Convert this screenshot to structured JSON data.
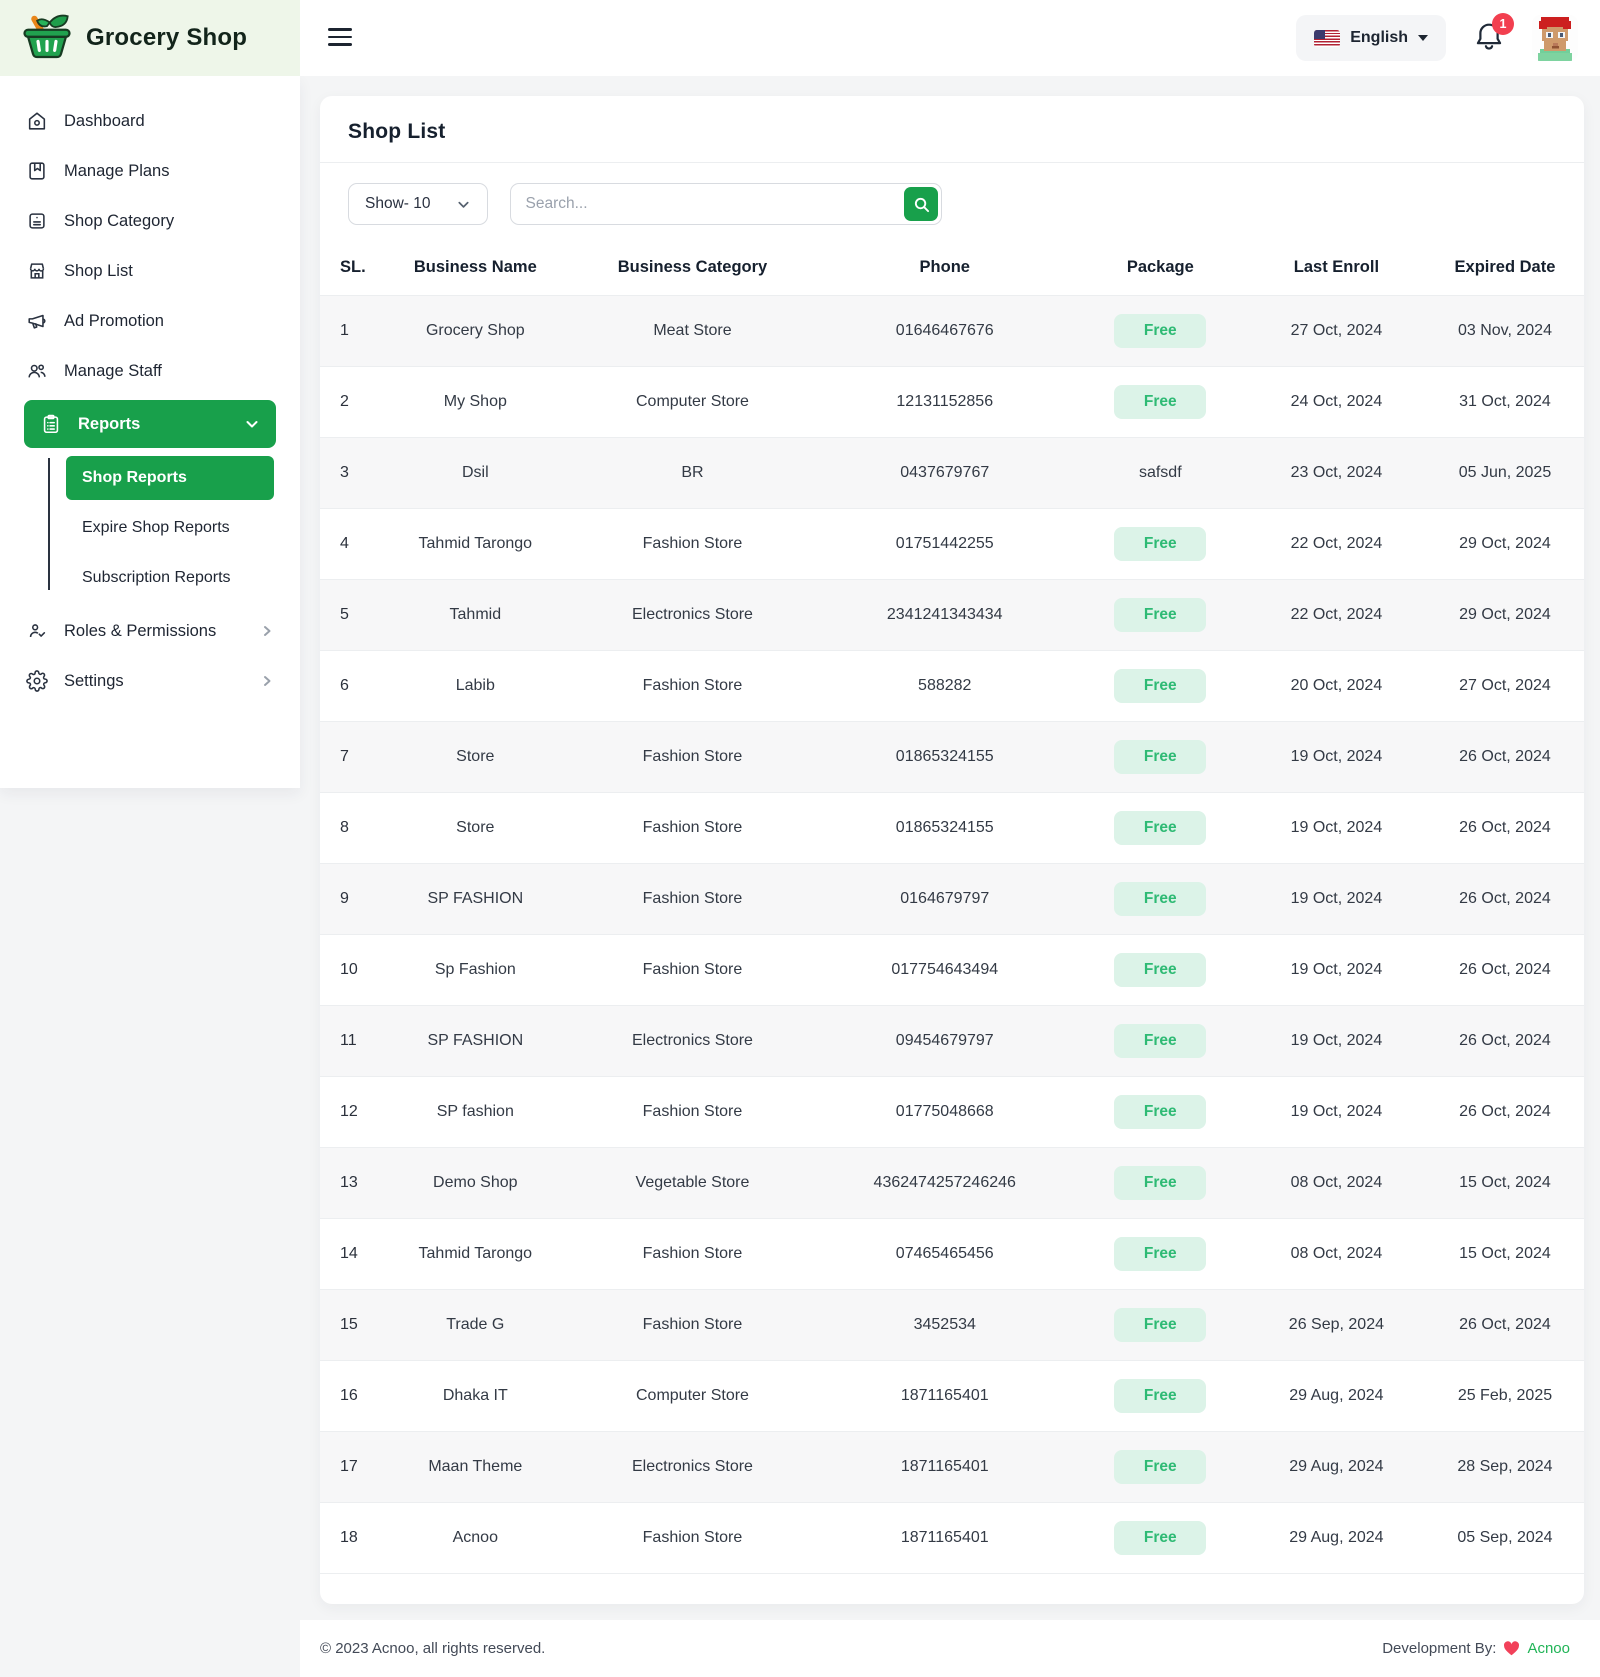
{
  "brand": {
    "name": "Grocery Shop"
  },
  "header": {
    "language": "English",
    "notification_count": "1"
  },
  "sidebar": {
    "items": [
      {
        "label": "Dashboard"
      },
      {
        "label": "Manage Plans"
      },
      {
        "label": "Shop Category"
      },
      {
        "label": "Shop List"
      },
      {
        "label": "Ad Promotion"
      },
      {
        "label": "Manage Staff"
      },
      {
        "label": "Reports"
      },
      {
        "label": "Roles & Permissions"
      },
      {
        "label": "Settings"
      }
    ],
    "reports_submenu": [
      {
        "label": "Shop Reports",
        "active": true
      },
      {
        "label": "Expire Shop Reports",
        "active": false
      },
      {
        "label": "Subscription Reports",
        "active": false
      }
    ]
  },
  "main": {
    "title": "Shop List",
    "show_select": "Show- 10",
    "search_placeholder": "Search...",
    "table": {
      "columns": [
        "SL.",
        "Business Name",
        "Business Category",
        "Phone",
        "Package",
        "Last Enroll",
        "Expired Date"
      ],
      "rows": [
        {
          "sl": "1",
          "name": "Grocery Shop",
          "category": "Meat Store",
          "phone": "01646467676",
          "package": "Free",
          "package_badge": true,
          "last_enroll": "27 Oct, 2024",
          "expired": "03 Nov, 2024"
        },
        {
          "sl": "2",
          "name": "My Shop",
          "category": "Computer Store",
          "phone": "12131152856",
          "package": "Free",
          "package_badge": true,
          "last_enroll": "24 Oct, 2024",
          "expired": "31 Oct, 2024"
        },
        {
          "sl": "3",
          "name": "Dsil",
          "category": "BR",
          "phone": "0437679767",
          "package": "safsdf",
          "package_badge": false,
          "last_enroll": "23 Oct, 2024",
          "expired": "05 Jun, 2025"
        },
        {
          "sl": "4",
          "name": "Tahmid Tarongo",
          "category": "Fashion Store",
          "phone": "01751442255",
          "package": "Free",
          "package_badge": true,
          "last_enroll": "22 Oct, 2024",
          "expired": "29 Oct, 2024"
        },
        {
          "sl": "5",
          "name": "Tahmid",
          "category": "Electronics Store",
          "phone": "2341241343434",
          "package": "Free",
          "package_badge": true,
          "last_enroll": "22 Oct, 2024",
          "expired": "29 Oct, 2024"
        },
        {
          "sl": "6",
          "name": "Labib",
          "category": "Fashion Store",
          "phone": "588282",
          "package": "Free",
          "package_badge": true,
          "last_enroll": "20 Oct, 2024",
          "expired": "27 Oct, 2024"
        },
        {
          "sl": "7",
          "name": "Store",
          "category": "Fashion Store",
          "phone": "01865324155",
          "package": "Free",
          "package_badge": true,
          "last_enroll": "19 Oct, 2024",
          "expired": "26 Oct, 2024"
        },
        {
          "sl": "8",
          "name": "Store",
          "category": "Fashion Store",
          "phone": "01865324155",
          "package": "Free",
          "package_badge": true,
          "last_enroll": "19 Oct, 2024",
          "expired": "26 Oct, 2024"
        },
        {
          "sl": "9",
          "name": "SP FASHION",
          "category": "Fashion Store",
          "phone": "0164679797",
          "package": "Free",
          "package_badge": true,
          "last_enroll": "19 Oct, 2024",
          "expired": "26 Oct, 2024"
        },
        {
          "sl": "10",
          "name": "Sp Fashion",
          "category": "Fashion Store",
          "phone": "017754643494",
          "package": "Free",
          "package_badge": true,
          "last_enroll": "19 Oct, 2024",
          "expired": "26 Oct, 2024"
        },
        {
          "sl": "11",
          "name": "SP FASHION",
          "category": "Electronics Store",
          "phone": "09454679797",
          "package": "Free",
          "package_badge": true,
          "last_enroll": "19 Oct, 2024",
          "expired": "26 Oct, 2024"
        },
        {
          "sl": "12",
          "name": "SP fashion",
          "category": "Fashion Store",
          "phone": "01775048668",
          "package": "Free",
          "package_badge": true,
          "last_enroll": "19 Oct, 2024",
          "expired": "26 Oct, 2024"
        },
        {
          "sl": "13",
          "name": "Demo Shop",
          "category": "Vegetable Store",
          "phone": "4362474257246246",
          "package": "Free",
          "package_badge": true,
          "last_enroll": "08 Oct, 2024",
          "expired": "15 Oct, 2024"
        },
        {
          "sl": "14",
          "name": "Tahmid Tarongo",
          "category": "Fashion Store",
          "phone": "07465465456",
          "package": "Free",
          "package_badge": true,
          "last_enroll": "08 Oct, 2024",
          "expired": "15 Oct, 2024"
        },
        {
          "sl": "15",
          "name": "Trade G",
          "category": "Fashion Store",
          "phone": "3452534",
          "package": "Free",
          "package_badge": true,
          "last_enroll": "26 Sep, 2024",
          "expired": "26 Oct, 2024"
        },
        {
          "sl": "16",
          "name": "Dhaka IT",
          "category": "Computer Store",
          "phone": "1871165401",
          "package": "Free",
          "package_badge": true,
          "last_enroll": "29 Aug, 2024",
          "expired": "25 Feb, 2025"
        },
        {
          "sl": "17",
          "name": "Maan Theme",
          "category": "Electronics Store",
          "phone": "1871165401",
          "package": "Free",
          "package_badge": true,
          "last_enroll": "29 Aug, 2024",
          "expired": "28 Sep, 2024"
        },
        {
          "sl": "18",
          "name": "Acnoo",
          "category": "Fashion Store",
          "phone": "1871165401",
          "package": "Free",
          "package_badge": true,
          "last_enroll": "29 Aug, 2024",
          "expired": "05 Sep, 2024"
        }
      ]
    }
  },
  "footer": {
    "copyright": "© 2023 Acnoo, all rights reserved.",
    "dev_by": "Development By:",
    "dev_name": "Acnoo"
  },
  "colors": {
    "primary_green": "#18a04b",
    "badge_bg": "#dcf3e8",
    "badge_text": "#2eba74",
    "notification_red": "#f23f4f",
    "logo_zone_bg": "#eef6e9"
  }
}
